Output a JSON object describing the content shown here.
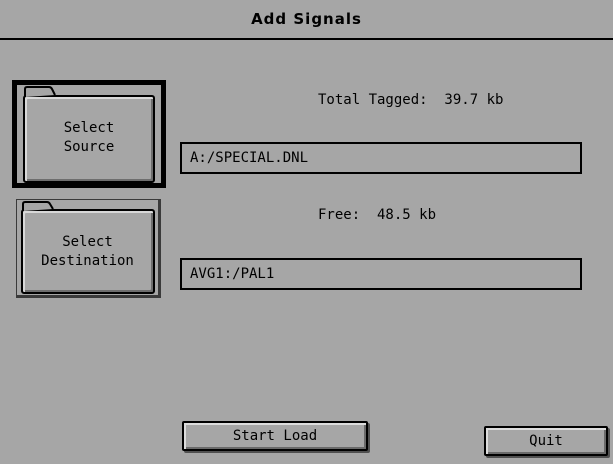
{
  "window": {
    "title": "Add Signals"
  },
  "source": {
    "button_label_line1": "Select",
    "button_label_line2": "Source",
    "info": "Total Tagged:  39.7 kb",
    "path": "A:/SPECIAL.DNL"
  },
  "destination": {
    "button_label_line1": "Select",
    "button_label_line2": "Destination",
    "info": "Free:  48.5 kb",
    "path": "AVG1:/PAL1"
  },
  "actions": {
    "start_label": "Start Load",
    "quit_label": "Quit"
  },
  "icons": {
    "folder": "folder-icon"
  },
  "colors": {
    "background": "#a6a6a6",
    "border": "#000000"
  }
}
